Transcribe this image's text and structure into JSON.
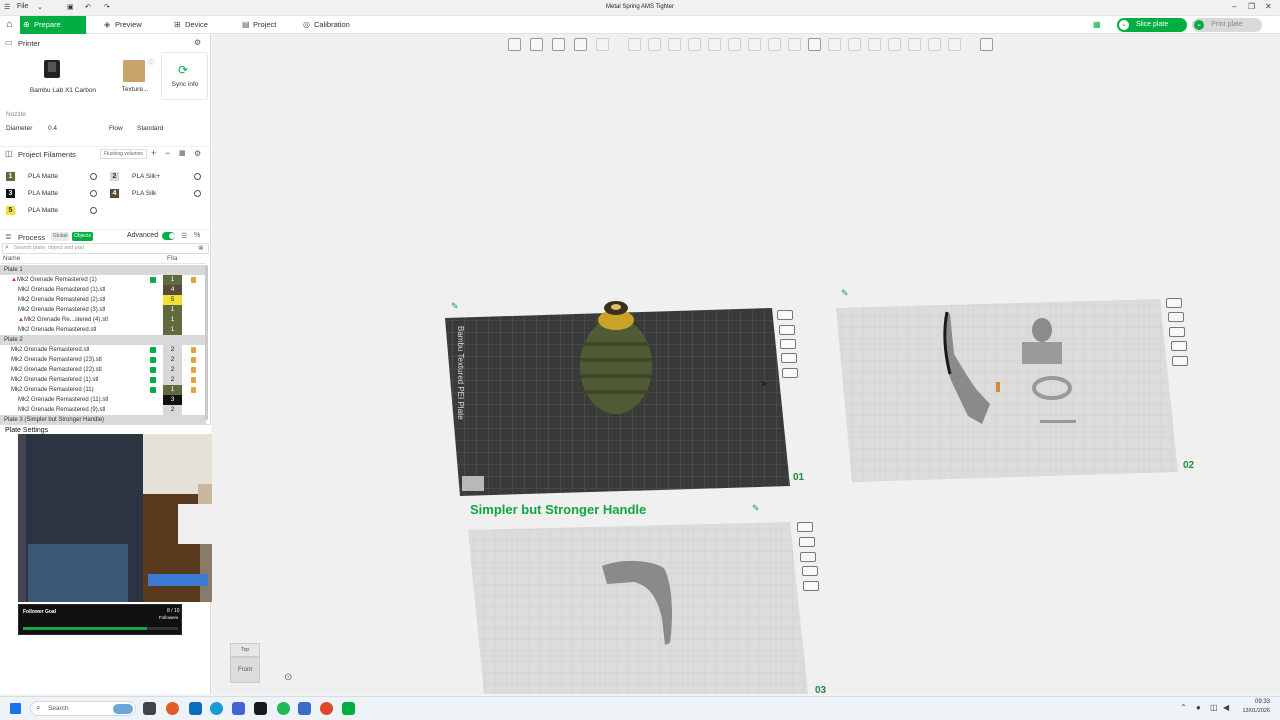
{
  "window": {
    "title": "Metal Spring AMS Tighter",
    "file_menu": "File"
  },
  "tabs": {
    "prepare": "Prepare",
    "preview": "Preview",
    "device": "Device",
    "project": "Project",
    "calibration": "Calibration"
  },
  "actions": {
    "slice_plate": "Slice plate",
    "print_plate": "Print plate"
  },
  "printer": {
    "section": "Printer",
    "model": "Bambu Lab X1 Carbon",
    "plate_type": "Texture...",
    "sync": "Sync info",
    "nozzle_label": "Nozzle",
    "diameter_label": "Diameter",
    "diameter_value": "0.4",
    "flow_label": "Flow",
    "flow_value": "Standard"
  },
  "filaments": {
    "section": "Project Filaments",
    "flushing": "Flushing volumes",
    "items": [
      {
        "num": "1",
        "name": "PLA Matte",
        "color": "#5f6b3c"
      },
      {
        "num": "2",
        "name": "PLA Silk+",
        "color": "#d8d8d8"
      },
      {
        "num": "3",
        "name": "PLA Matte",
        "color": "#111111"
      },
      {
        "num": "4",
        "name": "PLA Silk",
        "color": "#5b4a3a"
      },
      {
        "num": "5",
        "name": "PLA Matte",
        "color": "#f1e23a"
      }
    ]
  },
  "process": {
    "section": "Process",
    "global": "Global",
    "objects": "Objects",
    "advanced": "Advanced",
    "search_placeholder": "Search plate, object and part",
    "col_name": "Name",
    "col_fila": "Fila"
  },
  "tree": [
    {
      "name": "Plate 1",
      "level": 0,
      "plate": true
    },
    {
      "name": "Mk2 Grenade Remastered (1)",
      "level": 1,
      "fila": "1",
      "warn": true,
      "check": true
    },
    {
      "name": "Mk2 Grenade Remastered (1).stl",
      "level": 2,
      "fila": "4"
    },
    {
      "name": "Mk2 Grenade Remastered (2).stl",
      "level": 2,
      "fila": "5"
    },
    {
      "name": "Mk2 Grenade Remastered (3).stl",
      "level": 2,
      "fila": "1"
    },
    {
      "name": "Mk2 Grenade Re...stered (4).stl",
      "level": 2,
      "fila": "1",
      "warn": true
    },
    {
      "name": "Mk2 Grenade Remastered.stl",
      "level": 2,
      "fila": "1"
    },
    {
      "name": "Plate 2",
      "level": 0,
      "plate": true
    },
    {
      "name": "Mk2 Grenade Remastered.stl",
      "level": 1,
      "fila": "2",
      "check": true
    },
    {
      "name": "Mk2 Grenade Remastered (23).stl",
      "level": 1,
      "fila": "2",
      "check": true
    },
    {
      "name": "Mk2 Grenade Remastered (22).stl",
      "level": 1,
      "fila": "2",
      "check": true
    },
    {
      "name": "Mk2 Grenade Remastered (1).stl",
      "level": 1,
      "fila": "2",
      "check": true
    },
    {
      "name": "Mk2 Grenade Remastered (11)",
      "level": 1,
      "fila": "1",
      "check": true
    },
    {
      "name": "Mk2 Grenade Remastered (11).stl",
      "level": 2,
      "fila": "3"
    },
    {
      "name": "Mk2 Grenade Remastered (9).stl",
      "level": 2,
      "fila": "2"
    },
    {
      "name": "Plate 3 (Simpler but Stronger Handle)",
      "level": 0,
      "plate": true
    }
  ],
  "plate_settings": "Plate Settings",
  "follower_goal": {
    "title": "Follower Goal",
    "count": "8 / 10",
    "label": "Followers",
    "progress": 0.8
  },
  "viewport": {
    "plate1_text": "Bambu Textured PEI Plate",
    "plate1_num": "01",
    "plate2_num": "02",
    "plate3_num": "03",
    "plate3_title": "Simpler but Stronger Handle",
    "cube_top": "Top",
    "cube_front": "Front"
  },
  "taskbar": {
    "search": "Search",
    "time": "09:33",
    "date": "13/01/2026"
  }
}
